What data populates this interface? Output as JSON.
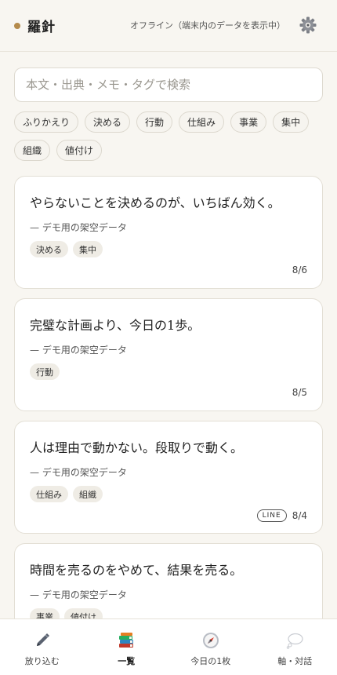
{
  "header": {
    "title": "羅針",
    "status": "オフライン（端末内のデータを表示中）",
    "accent": "#b58b4c"
  },
  "search": {
    "placeholder": "本文・出典・メモ・タグで検索",
    "value": ""
  },
  "filters": [
    "ふりかえり",
    "決める",
    "行動",
    "仕組み",
    "事業",
    "集中",
    "組織",
    "値付け"
  ],
  "cards": [
    {
      "quote": "やらないことを決めるのが、いちばん効く。",
      "source": "— デモ用の架空データ",
      "tags": [
        "決める",
        "集中"
      ],
      "badge": "",
      "date": "8/6"
    },
    {
      "quote": "完璧な計画より、今日の1歩。",
      "source": "— デモ用の架空データ",
      "tags": [
        "行動"
      ],
      "badge": "",
      "date": "8/5"
    },
    {
      "quote": "人は理由で動かない。段取りで動く。",
      "source": "— デモ用の架空データ",
      "tags": [
        "仕組み",
        "組織"
      ],
      "badge": "LINE",
      "date": "8/4"
    },
    {
      "quote": "時間を売るのをやめて、結果を売る。",
      "source": "— デモ用の架空データ",
      "tags": [
        "事業",
        "値付け"
      ],
      "badge": "",
      "date": ""
    }
  ],
  "nav": [
    {
      "label": "放り込む",
      "icon": "pen-icon",
      "active": false
    },
    {
      "label": "一覧",
      "icon": "books-icon",
      "active": true
    },
    {
      "label": "今日の1枚",
      "icon": "compass-icon",
      "active": false
    },
    {
      "label": "軸・対話",
      "icon": "thought-bubble-icon",
      "active": false
    }
  ]
}
